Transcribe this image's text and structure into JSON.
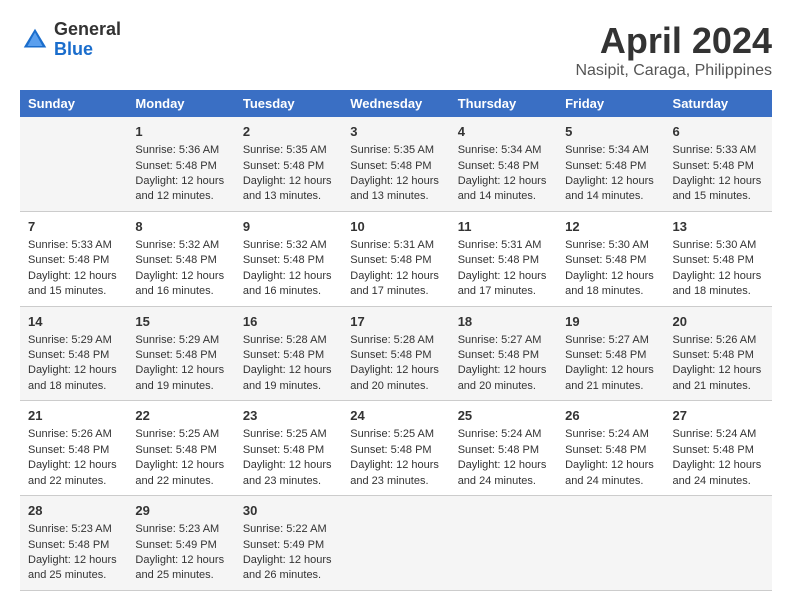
{
  "header": {
    "logo": {
      "general": "General",
      "blue": "Blue"
    },
    "title": "April 2024",
    "subtitle": "Nasipit, Caraga, Philippines"
  },
  "days_of_week": [
    "Sunday",
    "Monday",
    "Tuesday",
    "Wednesday",
    "Thursday",
    "Friday",
    "Saturday"
  ],
  "weeks": [
    [
      {
        "day": "",
        "info": ""
      },
      {
        "day": "1",
        "info": "Sunrise: 5:36 AM\nSunset: 5:48 PM\nDaylight: 12 hours\nand 12 minutes."
      },
      {
        "day": "2",
        "info": "Sunrise: 5:35 AM\nSunset: 5:48 PM\nDaylight: 12 hours\nand 13 minutes."
      },
      {
        "day": "3",
        "info": "Sunrise: 5:35 AM\nSunset: 5:48 PM\nDaylight: 12 hours\nand 13 minutes."
      },
      {
        "day": "4",
        "info": "Sunrise: 5:34 AM\nSunset: 5:48 PM\nDaylight: 12 hours\nand 14 minutes."
      },
      {
        "day": "5",
        "info": "Sunrise: 5:34 AM\nSunset: 5:48 PM\nDaylight: 12 hours\nand 14 minutes."
      },
      {
        "day": "6",
        "info": "Sunrise: 5:33 AM\nSunset: 5:48 PM\nDaylight: 12 hours\nand 15 minutes."
      }
    ],
    [
      {
        "day": "7",
        "info": "Sunrise: 5:33 AM\nSunset: 5:48 PM\nDaylight: 12 hours\nand 15 minutes."
      },
      {
        "day": "8",
        "info": "Sunrise: 5:32 AM\nSunset: 5:48 PM\nDaylight: 12 hours\nand 16 minutes."
      },
      {
        "day": "9",
        "info": "Sunrise: 5:32 AM\nSunset: 5:48 PM\nDaylight: 12 hours\nand 16 minutes."
      },
      {
        "day": "10",
        "info": "Sunrise: 5:31 AM\nSunset: 5:48 PM\nDaylight: 12 hours\nand 17 minutes."
      },
      {
        "day": "11",
        "info": "Sunrise: 5:31 AM\nSunset: 5:48 PM\nDaylight: 12 hours\nand 17 minutes."
      },
      {
        "day": "12",
        "info": "Sunrise: 5:30 AM\nSunset: 5:48 PM\nDaylight: 12 hours\nand 18 minutes."
      },
      {
        "day": "13",
        "info": "Sunrise: 5:30 AM\nSunset: 5:48 PM\nDaylight: 12 hours\nand 18 minutes."
      }
    ],
    [
      {
        "day": "14",
        "info": "Sunrise: 5:29 AM\nSunset: 5:48 PM\nDaylight: 12 hours\nand 18 minutes."
      },
      {
        "day": "15",
        "info": "Sunrise: 5:29 AM\nSunset: 5:48 PM\nDaylight: 12 hours\nand 19 minutes."
      },
      {
        "day": "16",
        "info": "Sunrise: 5:28 AM\nSunset: 5:48 PM\nDaylight: 12 hours\nand 19 minutes."
      },
      {
        "day": "17",
        "info": "Sunrise: 5:28 AM\nSunset: 5:48 PM\nDaylight: 12 hours\nand 20 minutes."
      },
      {
        "day": "18",
        "info": "Sunrise: 5:27 AM\nSunset: 5:48 PM\nDaylight: 12 hours\nand 20 minutes."
      },
      {
        "day": "19",
        "info": "Sunrise: 5:27 AM\nSunset: 5:48 PM\nDaylight: 12 hours\nand 21 minutes."
      },
      {
        "day": "20",
        "info": "Sunrise: 5:26 AM\nSunset: 5:48 PM\nDaylight: 12 hours\nand 21 minutes."
      }
    ],
    [
      {
        "day": "21",
        "info": "Sunrise: 5:26 AM\nSunset: 5:48 PM\nDaylight: 12 hours\nand 22 minutes."
      },
      {
        "day": "22",
        "info": "Sunrise: 5:25 AM\nSunset: 5:48 PM\nDaylight: 12 hours\nand 22 minutes."
      },
      {
        "day": "23",
        "info": "Sunrise: 5:25 AM\nSunset: 5:48 PM\nDaylight: 12 hours\nand 23 minutes."
      },
      {
        "day": "24",
        "info": "Sunrise: 5:25 AM\nSunset: 5:48 PM\nDaylight: 12 hours\nand 23 minutes."
      },
      {
        "day": "25",
        "info": "Sunrise: 5:24 AM\nSunset: 5:48 PM\nDaylight: 12 hours\nand 24 minutes."
      },
      {
        "day": "26",
        "info": "Sunrise: 5:24 AM\nSunset: 5:48 PM\nDaylight: 12 hours\nand 24 minutes."
      },
      {
        "day": "27",
        "info": "Sunrise: 5:24 AM\nSunset: 5:48 PM\nDaylight: 12 hours\nand 24 minutes."
      }
    ],
    [
      {
        "day": "28",
        "info": "Sunrise: 5:23 AM\nSunset: 5:48 PM\nDaylight: 12 hours\nand 25 minutes."
      },
      {
        "day": "29",
        "info": "Sunrise: 5:23 AM\nSunset: 5:49 PM\nDaylight: 12 hours\nand 25 minutes."
      },
      {
        "day": "30",
        "info": "Sunrise: 5:22 AM\nSunset: 5:49 PM\nDaylight: 12 hours\nand 26 minutes."
      },
      {
        "day": "",
        "info": ""
      },
      {
        "day": "",
        "info": ""
      },
      {
        "day": "",
        "info": ""
      },
      {
        "day": "",
        "info": ""
      }
    ]
  ]
}
